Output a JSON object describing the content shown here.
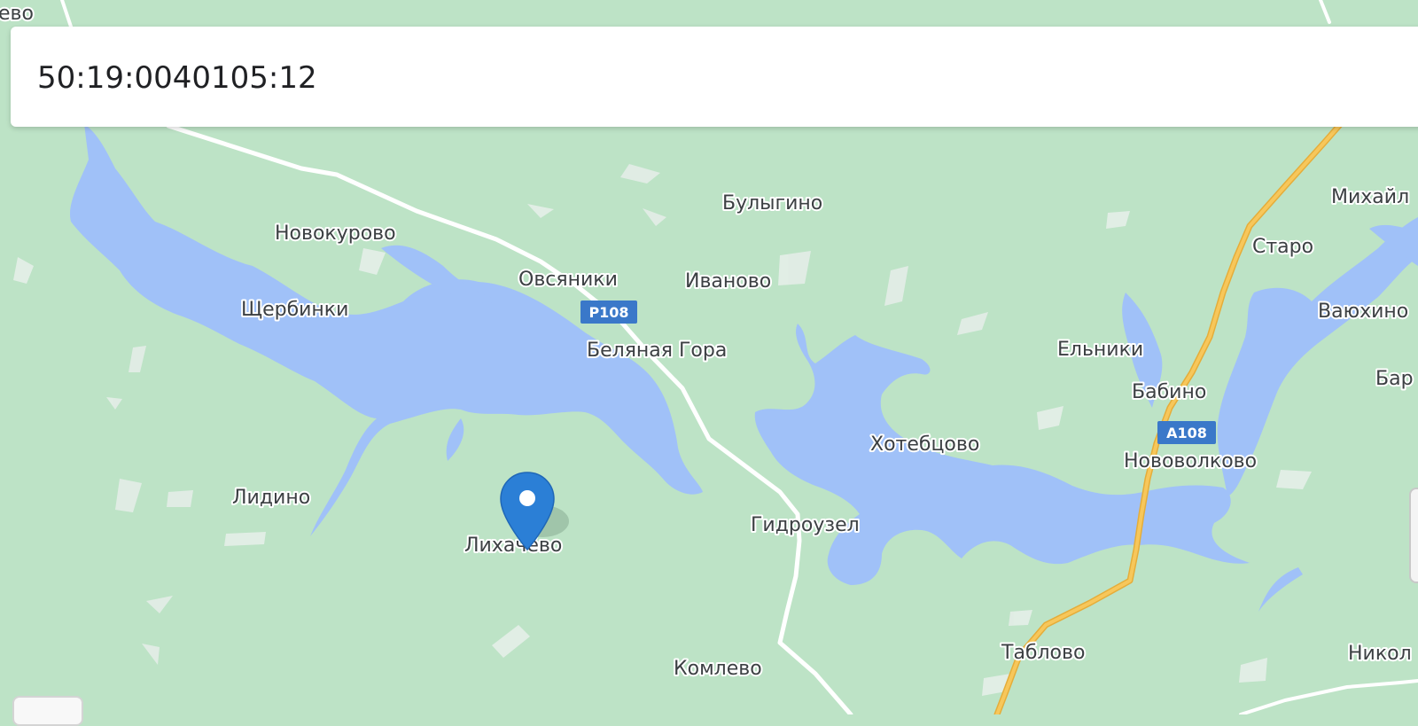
{
  "search": {
    "value": "50:19:0040105:12"
  },
  "map": {
    "colors": {
      "land": "#bde3c6",
      "water": "#a0c1f8",
      "road_major": "#f7c75b",
      "road_minor": "#ffffff",
      "shield": "#3a78c9",
      "marker": "#2b7fd6"
    },
    "marker_icon": "map-pin-icon",
    "places": [
      {
        "id": "edge-top-left",
        "label": "ево"
      },
      {
        "id": "bulygino",
        "label": "Булыгино"
      },
      {
        "id": "novokurovo",
        "label": "Новокурово"
      },
      {
        "id": "ovsyaniki",
        "label": "Овсяники"
      },
      {
        "id": "ivanovo",
        "label": "Иваново"
      },
      {
        "id": "shcherbinki",
        "label": "Щербинки"
      },
      {
        "id": "belyanaya-gora",
        "label": "Беляная Гора"
      },
      {
        "id": "lidino",
        "label": "Лидино"
      },
      {
        "id": "likhachevo",
        "label": "Лихачёво"
      },
      {
        "id": "gidrouzel",
        "label": "Гидроузел"
      },
      {
        "id": "komlevo",
        "label": "Комлево"
      },
      {
        "id": "khotebtsovo",
        "label": "Хотебцово"
      },
      {
        "id": "elniki",
        "label": "Ельники"
      },
      {
        "id": "babino",
        "label": "Бабино"
      },
      {
        "id": "novovolkovo",
        "label": "Нововолково"
      },
      {
        "id": "tablovo",
        "label": "Таблово"
      },
      {
        "id": "staro",
        "label": "Старо"
      },
      {
        "id": "mikhail",
        "label": "Михайл"
      },
      {
        "id": "vauokhino",
        "label": "Ваюхино"
      },
      {
        "id": "bar",
        "label": "Бар"
      },
      {
        "id": "nikol",
        "label": "Никол"
      }
    ],
    "shields": [
      {
        "id": "r108",
        "label": "Р108"
      },
      {
        "id": "a108",
        "label": "А108"
      }
    ]
  }
}
